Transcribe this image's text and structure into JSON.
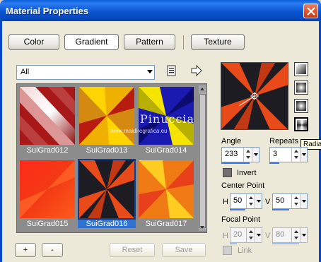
{
  "window": {
    "title": "Material Properties"
  },
  "tabs": [
    {
      "label": "Color"
    },
    {
      "label": "Gradient"
    },
    {
      "label": "Pattern"
    },
    {
      "label": "Texture"
    }
  ],
  "category_dropdown": {
    "selected": "All"
  },
  "watermark": {
    "name": "Pinuccia",
    "url": "www.maidiregrafica.eu"
  },
  "gradients": [
    {
      "label": "SuiGrad012"
    },
    {
      "label": "SuiGrad013"
    },
    {
      "label": "SuiGrad014"
    },
    {
      "label": "SuiGrad015"
    },
    {
      "label": "SuiGrad016",
      "selected": true
    },
    {
      "label": "SuiGrad017"
    }
  ],
  "angle": {
    "label": "Angle",
    "value": "233"
  },
  "repeats": {
    "label": "Repeats",
    "value": "3"
  },
  "invert": {
    "label": "Invert"
  },
  "center_point": {
    "label": "Center Point",
    "h_label": "H",
    "h_value": "50",
    "v_label": "V",
    "v_value": "50"
  },
  "focal_point": {
    "label": "Focal Point",
    "h_label": "H",
    "h_value": "20",
    "v_label": "V",
    "v_value": "80"
  },
  "link": {
    "label": "Link"
  },
  "tooltip": {
    "text": "Radial"
  },
  "buttons": {
    "add": "+",
    "remove": "-",
    "reset": "Reset",
    "save": "Save"
  }
}
